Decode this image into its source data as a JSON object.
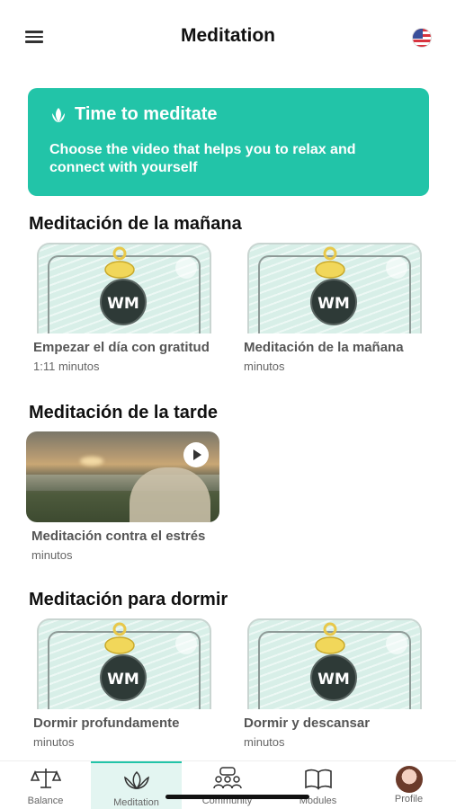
{
  "header": {
    "title": "Meditation",
    "menu_icon": "hamburger-icon",
    "flag_icon": "us-flag-icon"
  },
  "banner": {
    "title": "Time to meditate",
    "text": "Choose the video that helps you to relax and connect with yourself",
    "icon": "lotus-icon",
    "color": "#22c4a8"
  },
  "sections": [
    {
      "title": "Meditación de la mañana",
      "cards": [
        {
          "title": "Empezar el día con gratitud",
          "subtitle": "1:11 minutos",
          "logo": "WM"
        },
        {
          "title": "Meditación de la mañana",
          "subtitle": "minutos",
          "logo": "WM"
        }
      ]
    },
    {
      "title": "Meditación de la tarde",
      "cards": [
        {
          "title": "Meditación contra el estrés",
          "subtitle": "minutos"
        }
      ]
    },
    {
      "title": "Meditación para dormir",
      "cards": [
        {
          "title": "Dormir profundamente",
          "subtitle": "minutos",
          "logo": "WM"
        },
        {
          "title": "Dormir y descansar",
          "subtitle": "minutos",
          "logo": "WM"
        }
      ]
    }
  ],
  "tabbar": [
    {
      "label": "Balance",
      "icon": "scale-icon"
    },
    {
      "label": "Meditation",
      "icon": "lotus-icon",
      "active": true
    },
    {
      "label": "Community",
      "icon": "community-icon"
    },
    {
      "label": "Modules",
      "icon": "book-icon"
    },
    {
      "label": "Profile",
      "icon": "avatar-icon"
    }
  ]
}
